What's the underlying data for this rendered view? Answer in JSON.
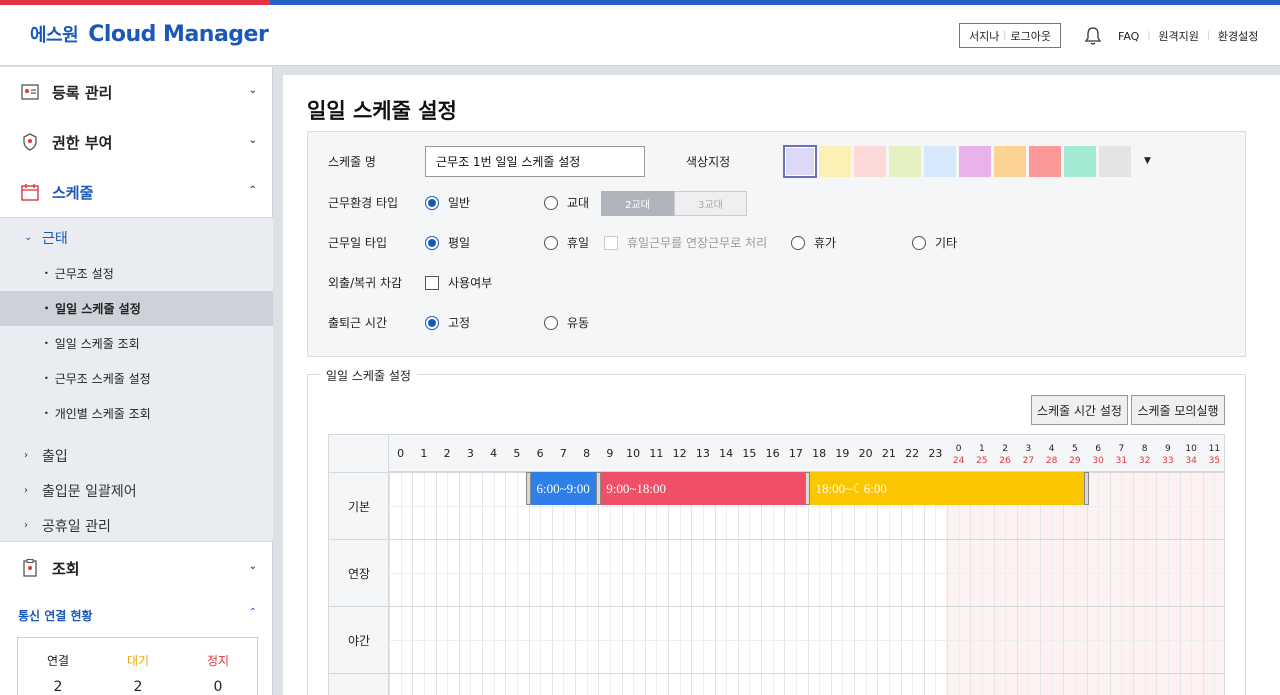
{
  "header": {
    "logo_kr": "에스원",
    "logo_en": "Cloud Manager",
    "user_name": "서지나",
    "logout": "로그아웃",
    "links": [
      "FAQ",
      "원격지원",
      "환경설정"
    ]
  },
  "sidebar": {
    "menus": [
      {
        "label": "등록 관리",
        "icon": "registration-icon"
      },
      {
        "label": "권한 부여",
        "icon": "permission-icon"
      },
      {
        "label": "스케줄",
        "icon": "calendar-icon"
      }
    ],
    "attendance": "근태",
    "attendance_items": [
      "근무조 설정",
      "일일 스케줄 설정",
      "일일 스케줄 조회",
      "근무조 스케줄 설정",
      "개인별 스케줄 조회"
    ],
    "other_items": [
      "출입",
      "출입문 일괄제어",
      "공휴일 관리"
    ],
    "lookup": "조회",
    "comm_title": "통신 연결 현황",
    "comm_cols": [
      {
        "label": "연결",
        "value": "2",
        "color": "#222222"
      },
      {
        "label": "대기",
        "value": "2",
        "color": "#f0a800"
      },
      {
        "label": "정지",
        "value": "0",
        "color": "#e3343f"
      }
    ]
  },
  "page": {
    "title": "일일 스케줄 설정",
    "schedule_name_label": "스케줄 명",
    "schedule_name_value": "근무조 1번 일일 스케줄 설정",
    "color_label": "색상지정",
    "swatches": [
      "#dcd8f7",
      "#fdf0b4",
      "#fdd9d9",
      "#e4f1c2",
      "#d7e8fb",
      "#eab2ec",
      "#fcd393",
      "#f99a97",
      "#a3e9d3",
      "#e4e4e4"
    ],
    "work_env_label": "근무환경 타입",
    "work_env_options": [
      "일반",
      "교대"
    ],
    "shift_tabs": [
      "2교대",
      "3교대"
    ],
    "workday_label": "근무일 타입",
    "workday_options": [
      "평일",
      "휴일",
      "휴가",
      "기타"
    ],
    "holiday_overtime": "휴일근무를 연장근무로 처리",
    "outing_label": "외출/복귀 차감",
    "outing_check": "사용여부",
    "commute_label": "출퇴근 시간",
    "commute_options": [
      "고정",
      "유동"
    ],
    "section_title": "일일 스케줄 설정",
    "btn_time_setting": "스케줄 시간 설정",
    "btn_simulation": "스케줄 모의실행"
  },
  "timeline": {
    "hours_day": [
      "0",
      "1",
      "2",
      "3",
      "4",
      "5",
      "6",
      "7",
      "8",
      "9",
      "10",
      "11",
      "12",
      "13",
      "14",
      "15",
      "16",
      "17",
      "18",
      "19",
      "20",
      "21",
      "22",
      "23"
    ],
    "hours_next_top": [
      "0",
      "1",
      "2",
      "3",
      "4",
      "5",
      "6",
      "7",
      "8",
      "9",
      "10",
      "11"
    ],
    "hours_next_bottom": [
      "24",
      "25",
      "26",
      "27",
      "28",
      "29",
      "30",
      "31",
      "32",
      "33",
      "34",
      "35"
    ],
    "rows": [
      "기본",
      "연장",
      "야간"
    ],
    "bars": [
      {
        "label": "6:00~9:00",
        "start": 6,
        "end": 9,
        "color": "#2e7fe8"
      },
      {
        "label": "9:00~18:00",
        "start": 9,
        "end": 18,
        "color": "#ef5067"
      },
      {
        "label": "18:00~☾6:00",
        "start": 18,
        "end": 30,
        "color": "#fbc600"
      }
    ]
  }
}
